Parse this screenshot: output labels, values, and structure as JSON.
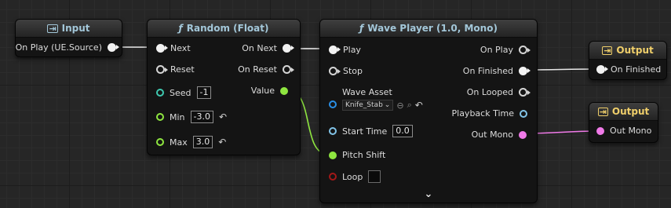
{
  "colors": {
    "exec": "#f2f2f2",
    "seed_pin": "#3fc9b0",
    "float_pin": "#8fe640",
    "object_pin": "#2a8fe6",
    "time_pin": "#82c4e8",
    "bool_pin": "#a31818",
    "audio_pin": "#f07ae8"
  },
  "input_node": {
    "title": "Input",
    "icon": "input-arrow-icon",
    "output_label": "On Play (UE.Source)"
  },
  "random_node": {
    "title": "Random (Float)",
    "icon": "function-icon",
    "inputs": {
      "next": "Next",
      "reset": "Reset",
      "seed": "Seed",
      "seed_value": "-1",
      "min": "Min",
      "min_value": "-3.0",
      "max": "Max",
      "max_value": "3.0"
    },
    "outputs": {
      "on_next": "On Next",
      "on_reset": "On Reset",
      "value": "Value"
    }
  },
  "wave_node": {
    "title": "Wave Player (1.0, Mono)",
    "icon": "function-icon",
    "inputs": {
      "play": "Play",
      "stop": "Stop",
      "wave_asset": "Wave Asset",
      "asset_value": "Knife_Stab",
      "start_time": "Start Time",
      "start_time_value": "0.0",
      "pitch_shift": "Pitch Shift",
      "loop": "Loop"
    },
    "outputs": {
      "on_play": "On Play",
      "on_finished": "On Finished",
      "on_looped": "On Looped",
      "playback_time": "Playback Time",
      "out_mono": "Out Mono"
    },
    "expand_icon": "chevron-down-icon"
  },
  "output_node_finished": {
    "title": "Output",
    "icon": "output-arrow-icon",
    "input_label": "On Finished"
  },
  "output_node_mono": {
    "title": "Output",
    "icon": "output-arrow-icon",
    "input_label": "Out Mono"
  }
}
